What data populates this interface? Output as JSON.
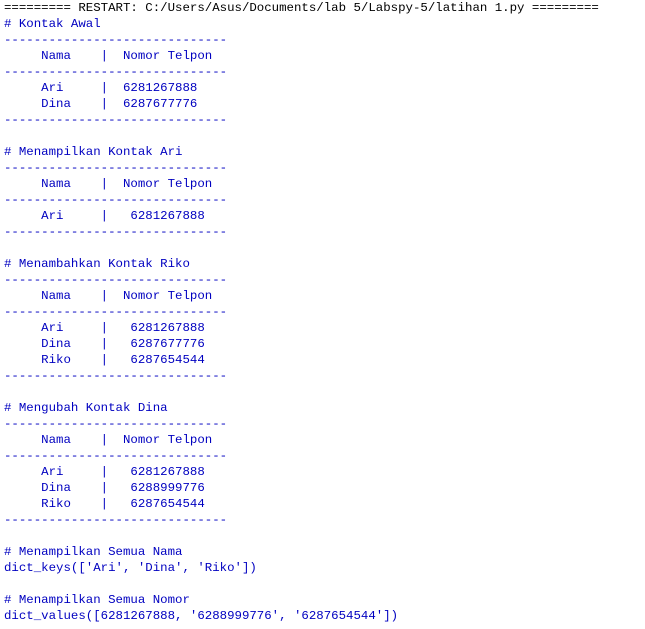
{
  "colors": {
    "background": "#ffffff",
    "output_text": "#0000c0",
    "restart_text": "#000000"
  },
  "restart_line": "========= RESTART: C:/Users/Asus/Documents/lab 5/Labspy-5/latihan 1.py =========",
  "output_lines": [
    "# Kontak Awal",
    "------------------------------",
    "     Nama    |  Nomor Telpon",
    "------------------------------",
    "     Ari     |  6281267888",
    "     Dina    |  6287677776",
    "------------------------------",
    "",
    "# Menampilkan Kontak Ari",
    "------------------------------",
    "     Nama    |  Nomor Telpon",
    "------------------------------",
    "     Ari     |   6281267888",
    "------------------------------",
    "",
    "# Menambahkan Kontak Riko",
    "------------------------------",
    "     Nama    |  Nomor Telpon",
    "------------------------------",
    "     Ari     |   6281267888",
    "     Dina    |   6287677776",
    "     Riko    |   6287654544",
    "------------------------------",
    "",
    "# Mengubah Kontak Dina",
    "------------------------------",
    "     Nama    |  Nomor Telpon",
    "------------------------------",
    "     Ari     |   6281267888",
    "     Dina    |   6288999776",
    "     Riko    |   6287654544",
    "------------------------------",
    "",
    "# Menampilkan Semua Nama",
    "dict_keys(['Ari', 'Dina', 'Riko'])",
    "",
    "# Menampilkan Semua Nomor",
    "dict_values([6281267888, '6288999776', '6287654544'])"
  ]
}
